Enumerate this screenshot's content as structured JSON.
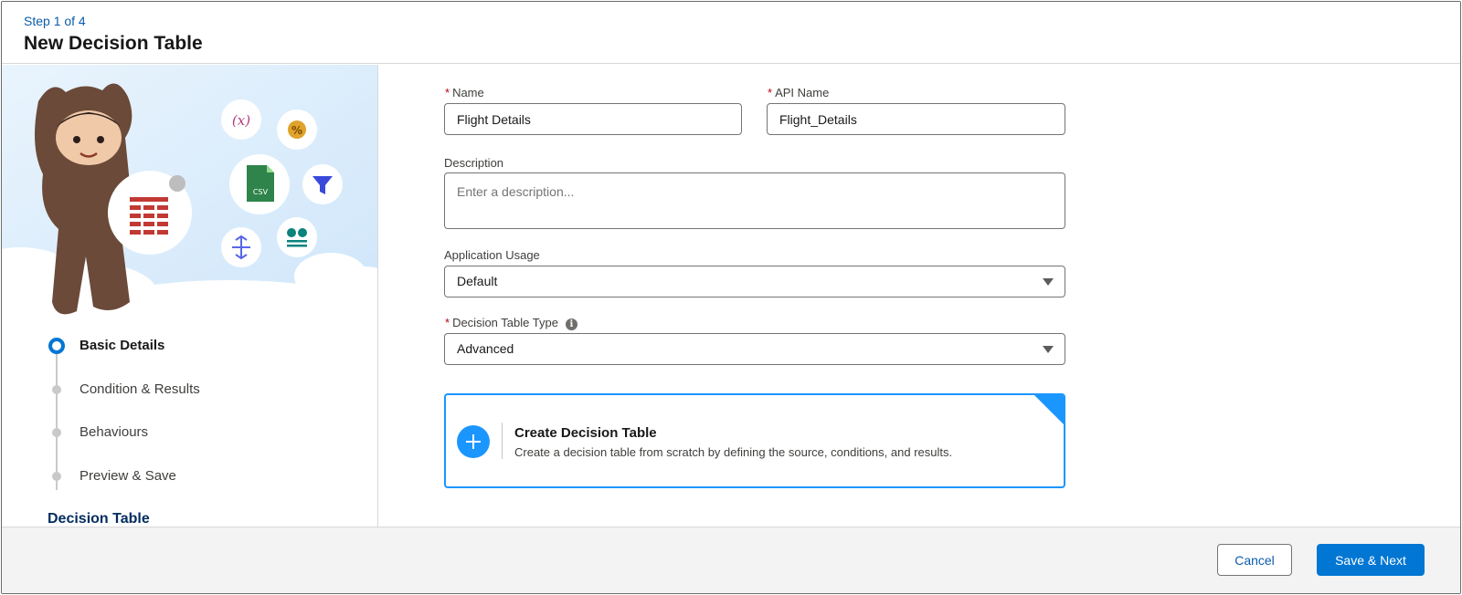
{
  "header": {
    "step": "Step 1 of 4",
    "title": "New Decision Table"
  },
  "sidebar": {
    "hero": {
      "variable_icon_text": "(x)",
      "percent_icon_text": "%",
      "csv_icon_text": "CSV"
    },
    "steps": [
      {
        "label": "Basic Details",
        "state": "current"
      },
      {
        "label": "Condition & Results",
        "state": "pending"
      },
      {
        "label": "Behaviours",
        "state": "pending"
      },
      {
        "label": "Preview & Save",
        "state": "pending"
      }
    ],
    "footer_label": "Decision Table"
  },
  "form": {
    "required_marker": "*",
    "name": {
      "label": "Name",
      "value": "Flight Details"
    },
    "api_name": {
      "label": "API Name",
      "value": "Flight_Details"
    },
    "description": {
      "label": "Description",
      "placeholder": "Enter a description..."
    },
    "application_usage": {
      "label": "Application Usage",
      "value": "Default"
    },
    "decision_table_type": {
      "label": "Decision Table Type",
      "value": "Advanced",
      "info_icon": "info-icon"
    }
  },
  "card": {
    "title": "Create Decision Table",
    "description": "Create a decision table from scratch by defining the source, conditions, and results."
  },
  "footer": {
    "cancel_label": "Cancel",
    "save_label": "Save & Next"
  },
  "colors": {
    "brand": "#0176d3",
    "link": "#0b5cab",
    "card_accent": "#1b96ff",
    "required": "#ba0517"
  }
}
